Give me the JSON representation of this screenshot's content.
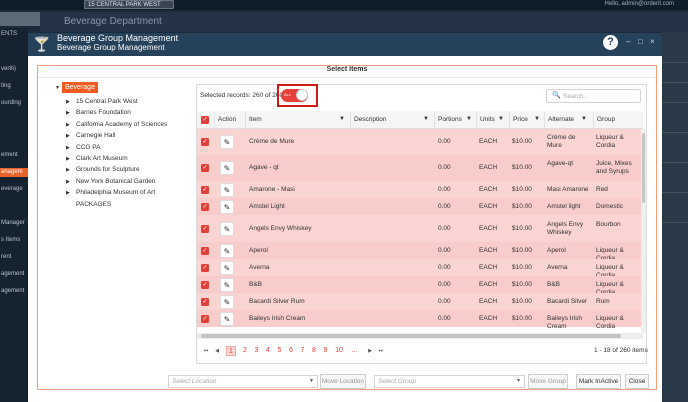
{
  "topbar": {
    "location": "15 CENTRAL PARK WEST",
    "user": "Hello, admin@orderit.com"
  },
  "background": {
    "header_title": "Beverage Department",
    "sidebar_items": [
      "ENTS",
      "ver8i)",
      "ting",
      "ourding",
      "ement",
      "anagem",
      "everage",
      "Manager",
      "s Items",
      "rent",
      "agement",
      "agement"
    ]
  },
  "modal": {
    "title": "Beverage Group Management",
    "subtitle": "Beverage Group Management",
    "help": "?",
    "minimize": "–",
    "restore": "□",
    "close": "×",
    "section_title": "Select Items"
  },
  "tree": {
    "root": "Beverage",
    "nodes": [
      {
        "label": "15 Central Park West",
        "arrow": true
      },
      {
        "label": "Barnes Foundation",
        "arrow": true
      },
      {
        "label": "California Academy of Sciences",
        "arrow": true
      },
      {
        "label": "Carnegie Hall",
        "arrow": true
      },
      {
        "label": "CCG PA",
        "arrow": true
      },
      {
        "label": "Clark Art Museum",
        "arrow": true
      },
      {
        "label": "Grounds for Sculpture",
        "arrow": true
      },
      {
        "label": "New York Botanical Garden",
        "arrow": true
      },
      {
        "label": "Philadelphia Museum of Art",
        "arrow": true
      },
      {
        "label": "PACKAGES",
        "arrow": false
      }
    ]
  },
  "grid": {
    "selected_records": "Selected records: 260 of 260",
    "toggle_label": "ALL",
    "toggle_on": true,
    "search_placeholder": "Search...",
    "columns": [
      "Action",
      "Item",
      "Description",
      "Portions",
      "Units",
      "Price",
      "Alternate",
      "Group"
    ],
    "rows": [
      {
        "item": "Crème de Mure",
        "description": "",
        "portions": "0.00",
        "units": "EACH",
        "price": "$10.00",
        "alternate": "Crème de Mure",
        "group": "Liqueur & Cordia"
      },
      {
        "item": "Agave - qt",
        "description": "",
        "portions": "0.00",
        "units": "EACH",
        "price": "$10.00",
        "alternate": "Agave-qt",
        "group": "Juice, Mixes and Syrups"
      },
      {
        "item": "Amarone - Masi",
        "description": "",
        "portions": "0.00",
        "units": "EACH",
        "price": "$10.00",
        "alternate": "Masi Amarone",
        "group": "Red"
      },
      {
        "item": "Amstel Light",
        "description": "",
        "portions": "0.00",
        "units": "EACH",
        "price": "$10.00",
        "alternate": "Amstel light",
        "group": "Domestic"
      },
      {
        "item": "Angels Envy Whiskey",
        "description": "",
        "portions": "0.00",
        "units": "EACH",
        "price": "$10.00",
        "alternate": "Angels Envy Whiskey",
        "group": "Bourbon"
      },
      {
        "item": "Aperol",
        "description": "",
        "portions": "0.00",
        "units": "EACH",
        "price": "$10.00",
        "alternate": "Aperol",
        "group": "Liqueur & Cordia"
      },
      {
        "item": "Averna",
        "description": "",
        "portions": "0.00",
        "units": "EACH",
        "price": "$10.00",
        "alternate": "Averna",
        "group": "Liqueur & Cordia"
      },
      {
        "item": "B&B",
        "description": "",
        "portions": "0.00",
        "units": "EACH",
        "price": "$10.00",
        "alternate": "B&B",
        "group": "Liqueur & Cordia"
      },
      {
        "item": "Bacardi Silver Rum",
        "description": "",
        "portions": "0.00",
        "units": "EACH",
        "price": "$10.00",
        "alternate": "Bacardi Silver",
        "group": "Rum"
      },
      {
        "item": "Baileys Irish Cream",
        "description": "",
        "portions": "0.00",
        "units": "EACH",
        "price": "$10.00",
        "alternate": "Baileys Irish Cream",
        "group": "Liqueur & Cordia"
      }
    ]
  },
  "pager": {
    "first": "⏮",
    "prev": "◀",
    "pages": [
      "1",
      "2",
      "3",
      "4",
      "5",
      "6",
      "7",
      "8",
      "9",
      "10",
      "..."
    ],
    "next": "▶",
    "last": "⏭",
    "current_page": 1,
    "summary": "1 - 18 of 260 items"
  },
  "footer": {
    "location_placeholder": "Select Location",
    "move_location": "Move Location",
    "group_placeholder": "Select Group",
    "move_group": "Move Group",
    "mark_inactive": "Mark InActive",
    "close": "Close"
  },
  "colors": {
    "accent": "#e0403a",
    "header": "#26415a",
    "row_selected": "#f9d4d2",
    "tree_root": "#ef5a1f"
  },
  "icons": {
    "modal": "cocktail-glass-icon",
    "edit": "pencil-icon",
    "filter": "funnel-icon",
    "search": "magnifier-icon",
    "help": "question-icon"
  }
}
